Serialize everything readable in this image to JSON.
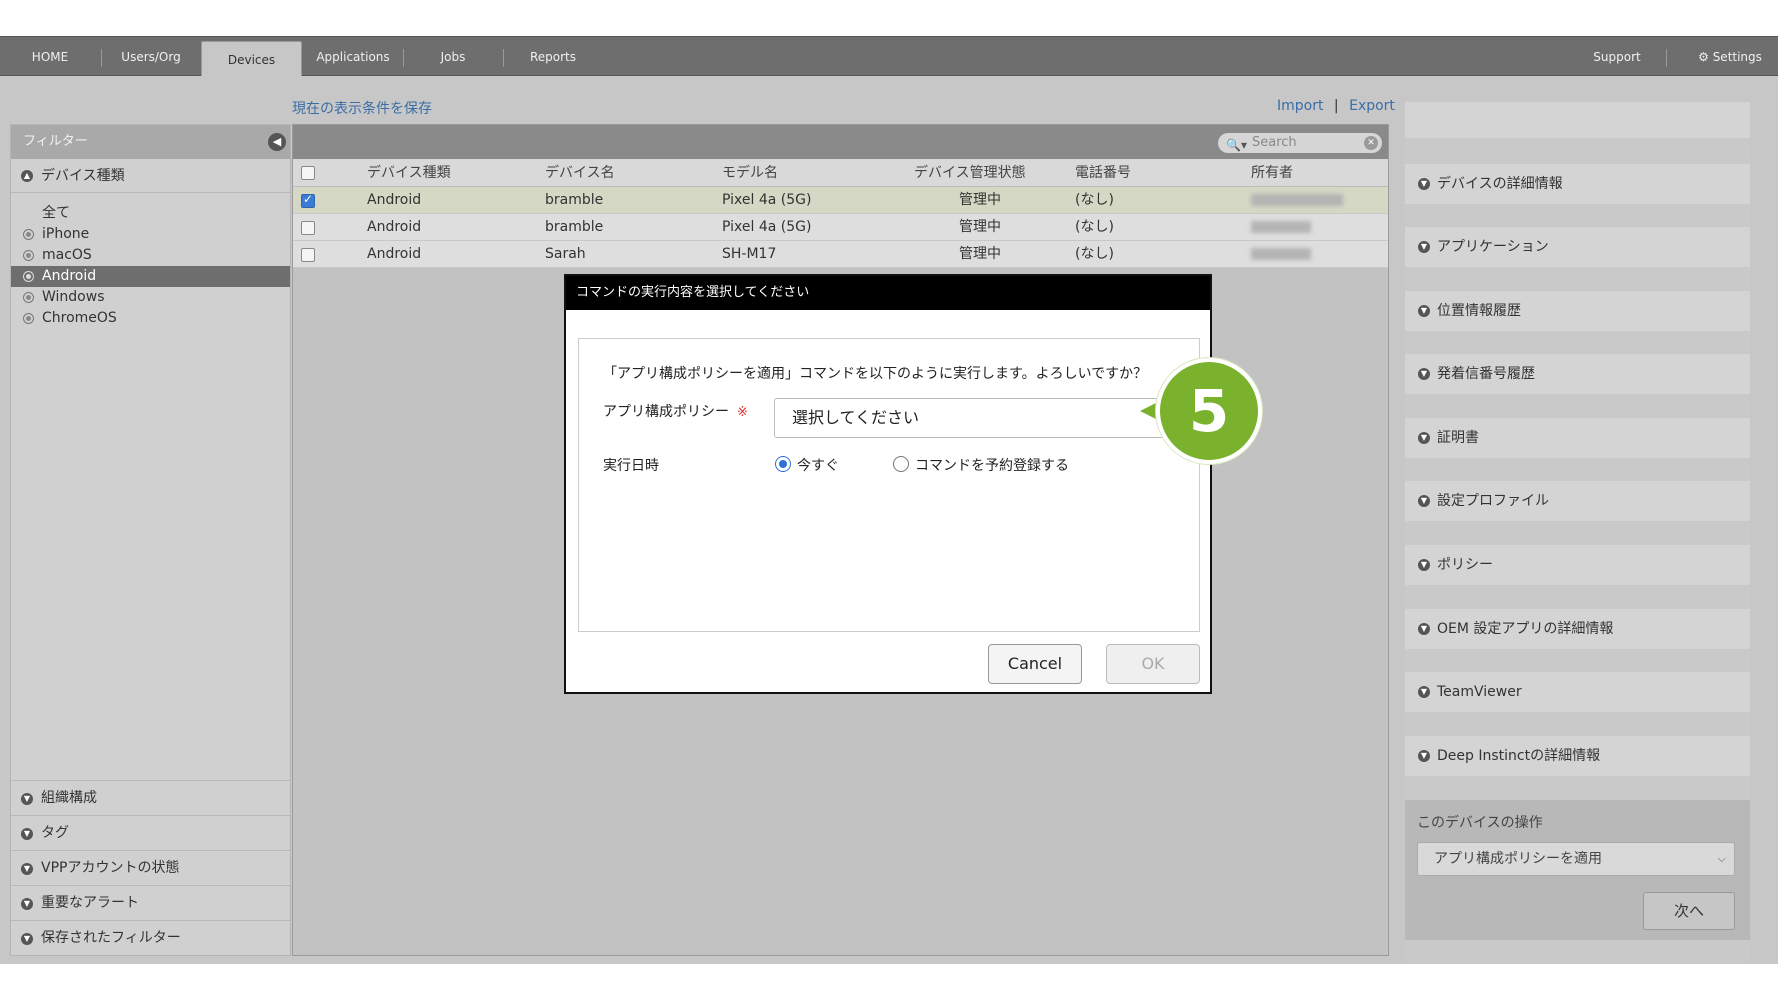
{
  "nav": {
    "tabs": [
      {
        "label": "HOME"
      },
      {
        "label": "Users/Org"
      },
      {
        "label": "Devices"
      },
      {
        "label": "Applications"
      },
      {
        "label": "Jobs"
      },
      {
        "label": "Reports"
      }
    ],
    "support": "Support",
    "settings": "Settings"
  },
  "toolbar": {
    "save_view": "現在の表示条件を保存",
    "import": "Import",
    "separator": "|",
    "export": "Export"
  },
  "sidebar": {
    "header": "フィルター",
    "device_type": "デバイス種類",
    "types": [
      {
        "label": "全て"
      },
      {
        "label": "iPhone"
      },
      {
        "label": "macOS"
      },
      {
        "label": "Android"
      },
      {
        "label": "Windows"
      },
      {
        "label": "ChromeOS"
      }
    ],
    "bottom_sections": [
      {
        "label": "組織構成"
      },
      {
        "label": "タグ"
      },
      {
        "label": "VPPアカウントの状態"
      },
      {
        "label": "重要なアラート"
      },
      {
        "label": "保存されたフィルター"
      }
    ]
  },
  "search": {
    "placeholder": "Search"
  },
  "table": {
    "columns": [
      "デバイス種類",
      "デバイス名",
      "モデル名",
      "デバイス管理状態",
      "電話番号",
      "所有者"
    ],
    "rows": [
      {
        "type": "Android",
        "name": "bramble",
        "model": "Pixel 4a (5G)",
        "status": "管理中",
        "phone": "(なし)",
        "checked": true
      },
      {
        "type": "Android",
        "name": "bramble",
        "model": "Pixel 4a (5G)",
        "status": "管理中",
        "phone": "(なし)",
        "checked": false
      },
      {
        "type": "Android",
        "name": "Sarah",
        "model": "SH-M17",
        "status": "管理中",
        "phone": "(なし)",
        "checked": false
      }
    ]
  },
  "right_panel": {
    "items": [
      {
        "label": "デバイスの詳細情報"
      },
      {
        "label": "アプリケーション"
      },
      {
        "label": "位置情報履歴"
      },
      {
        "label": "発着信番号履歴"
      },
      {
        "label": "証明書"
      },
      {
        "label": "設定プロファイル"
      },
      {
        "label": "ポリシー"
      },
      {
        "label": "OEM 設定アプリの詳細情報"
      },
      {
        "label": "TeamViewer"
      },
      {
        "label": "Deep Instinctの詳細情報"
      }
    ],
    "ops_title": "このデバイスの操作",
    "ops_selected": "アプリ構成ポリシーを適用",
    "next": "次へ"
  },
  "modal": {
    "title": "コマンドの実行内容を選択してください",
    "message": "「アプリ構成ポリシーを適用」コマンドを以下のように実行します。よろしいですか？",
    "policy_label": "アプリ構成ポリシー",
    "required_mark": "※",
    "policy_placeholder": "選択してください",
    "datetime_label": "実行日時",
    "option_now": "今すぐ",
    "option_schedule": "コマンドを予約登録する",
    "cancel": "Cancel",
    "ok": "OK"
  },
  "step_badge": "5",
  "colors": {
    "accent_green": "#7ab22e",
    "link_blue": "#3a6ea5",
    "radio_blue": "#2f6fd6"
  }
}
